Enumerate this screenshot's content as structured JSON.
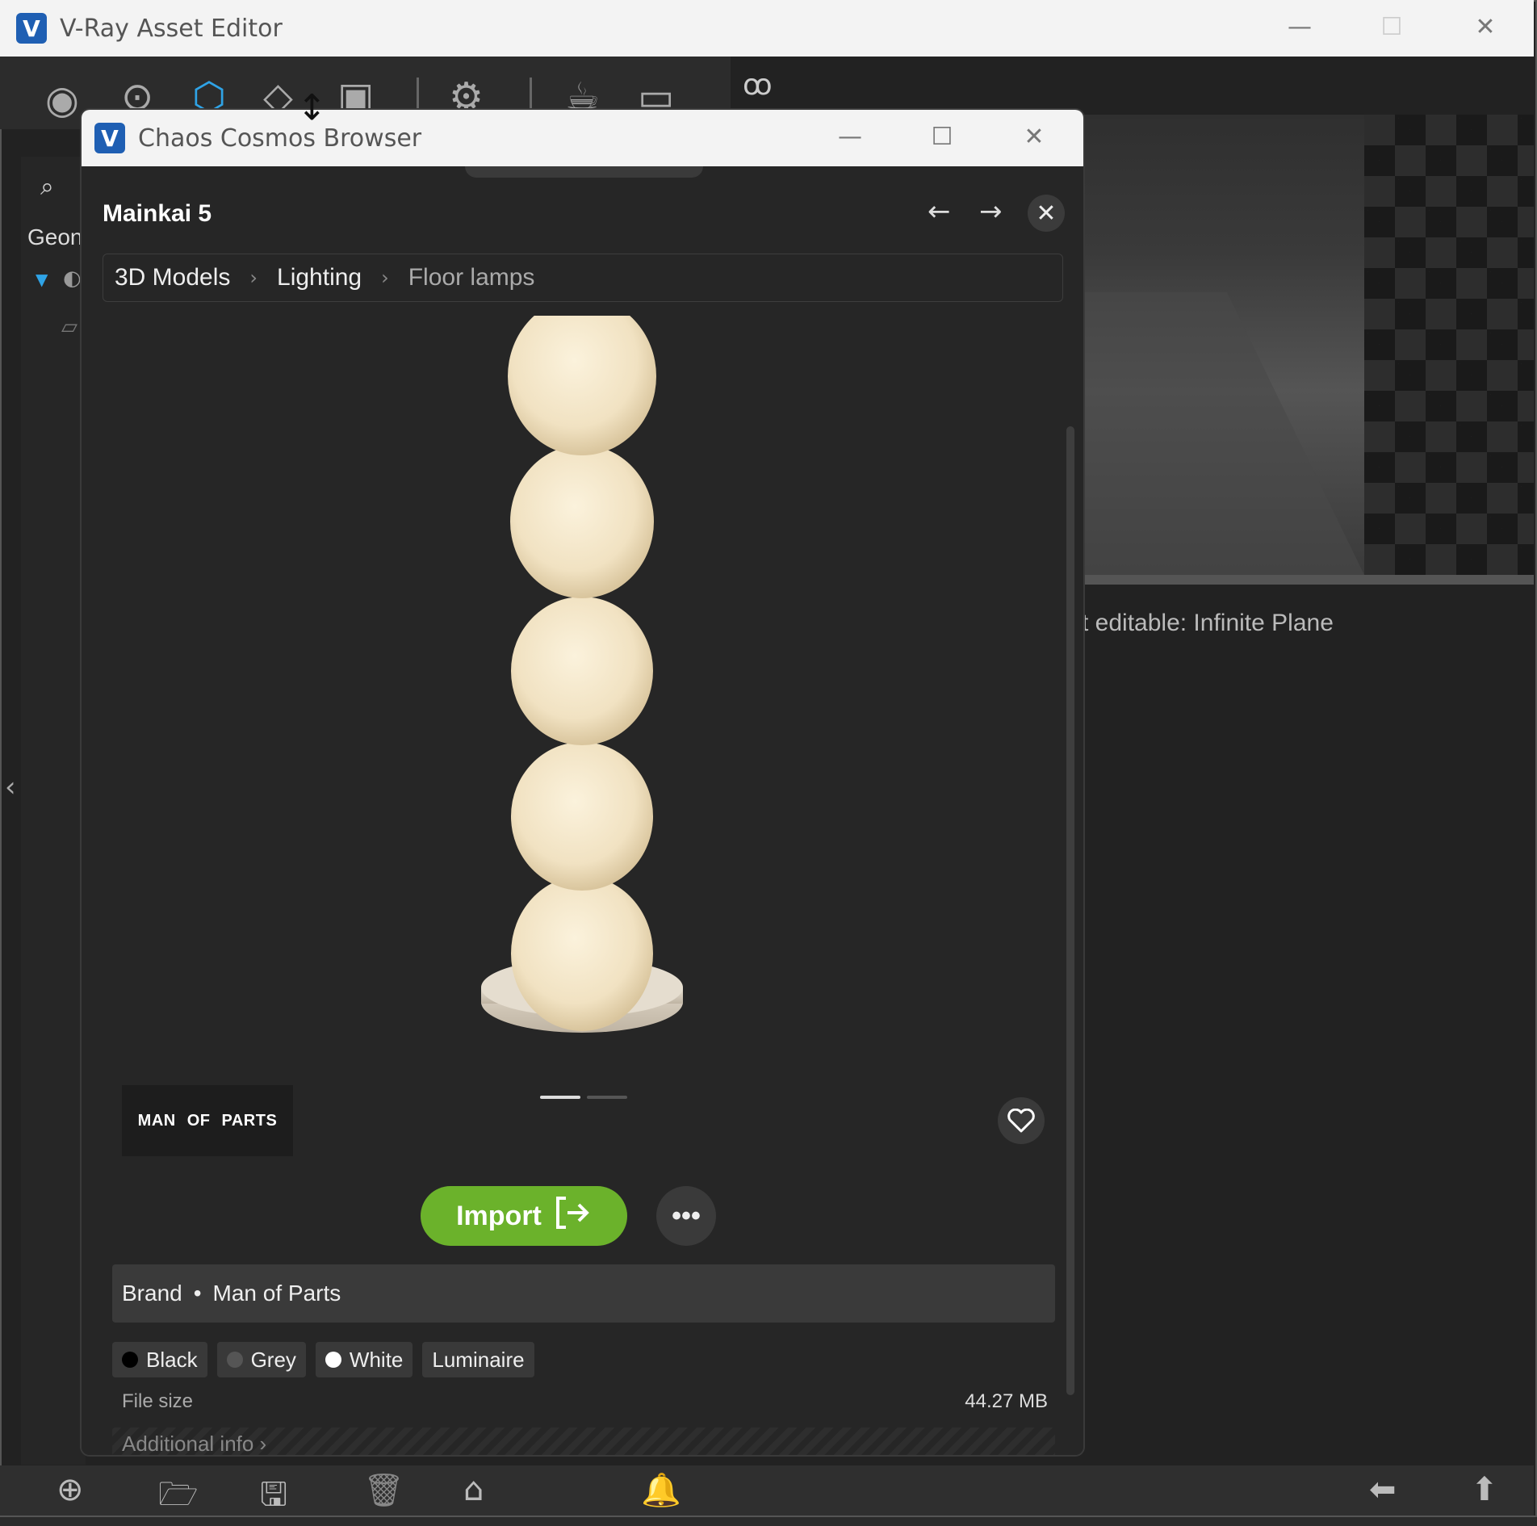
{
  "outer_window": {
    "title": "V-Ray Asset Editor",
    "minimize": "—",
    "maximize": "☐",
    "close": "✕"
  },
  "outer_left_panel": {
    "label": "Geon"
  },
  "outer_right": {
    "info": "t editable: Infinite Plane"
  },
  "cosmos_window": {
    "title": "Chaos Cosmos Browser",
    "minimize": "—",
    "maximize": "☐",
    "close": "✕"
  },
  "asset": {
    "name": "Mainkai 5",
    "breadcrumb": [
      "3D Models",
      "Lighting",
      "Floor lamps"
    ],
    "brand_logo": [
      "MAN",
      "OF",
      "PARTS"
    ],
    "import_label": "Import",
    "more_label": "•••",
    "brand_key": "Brand",
    "brand_sep": "•",
    "brand_value": "Man of Parts",
    "tags": [
      {
        "label": "Black",
        "color": "#000000"
      },
      {
        "label": "Grey",
        "color": "#555555"
      },
      {
        "label": "White",
        "color": "#ffffff"
      },
      {
        "label": "Luminaire",
        "color": null
      }
    ],
    "file_size_label": "File size",
    "file_size_value": "44.27 MB",
    "additional_info": "Additional info  ›"
  },
  "colors": {
    "accent_blue": "#1f5fb3",
    "import_green": "#6bb22b"
  }
}
